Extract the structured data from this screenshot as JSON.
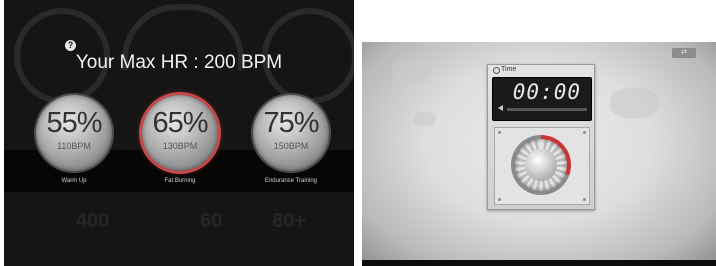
{
  "heart_rate": {
    "max_hr_text": "Your Max HR : 200 BPM",
    "help_glyph": "?",
    "zones": [
      {
        "percent": "55%",
        "bpm": "110BPM",
        "label": "Warm Up",
        "active": false
      },
      {
        "percent": "65%",
        "bpm": "130BPM",
        "label": "Fat Burning",
        "active": true
      },
      {
        "percent": "75%",
        "bpm": "150BPM",
        "label": "Endurance Training",
        "active": false
      }
    ],
    "background_numbers": [
      "400",
      "60",
      "80+"
    ]
  },
  "timer": {
    "title": "Time",
    "display": "00:00",
    "progress_fraction": 0.0,
    "corner_button_glyph": "⇄",
    "knob_accent_color": "#cc3333"
  },
  "colors": {
    "active_zone_ring": "#c64848",
    "left_background": "#151515",
    "right_background": "#dedede"
  },
  "icons": [
    "help-icon",
    "clock-icon",
    "speaker-icon",
    "knob-icon"
  ]
}
